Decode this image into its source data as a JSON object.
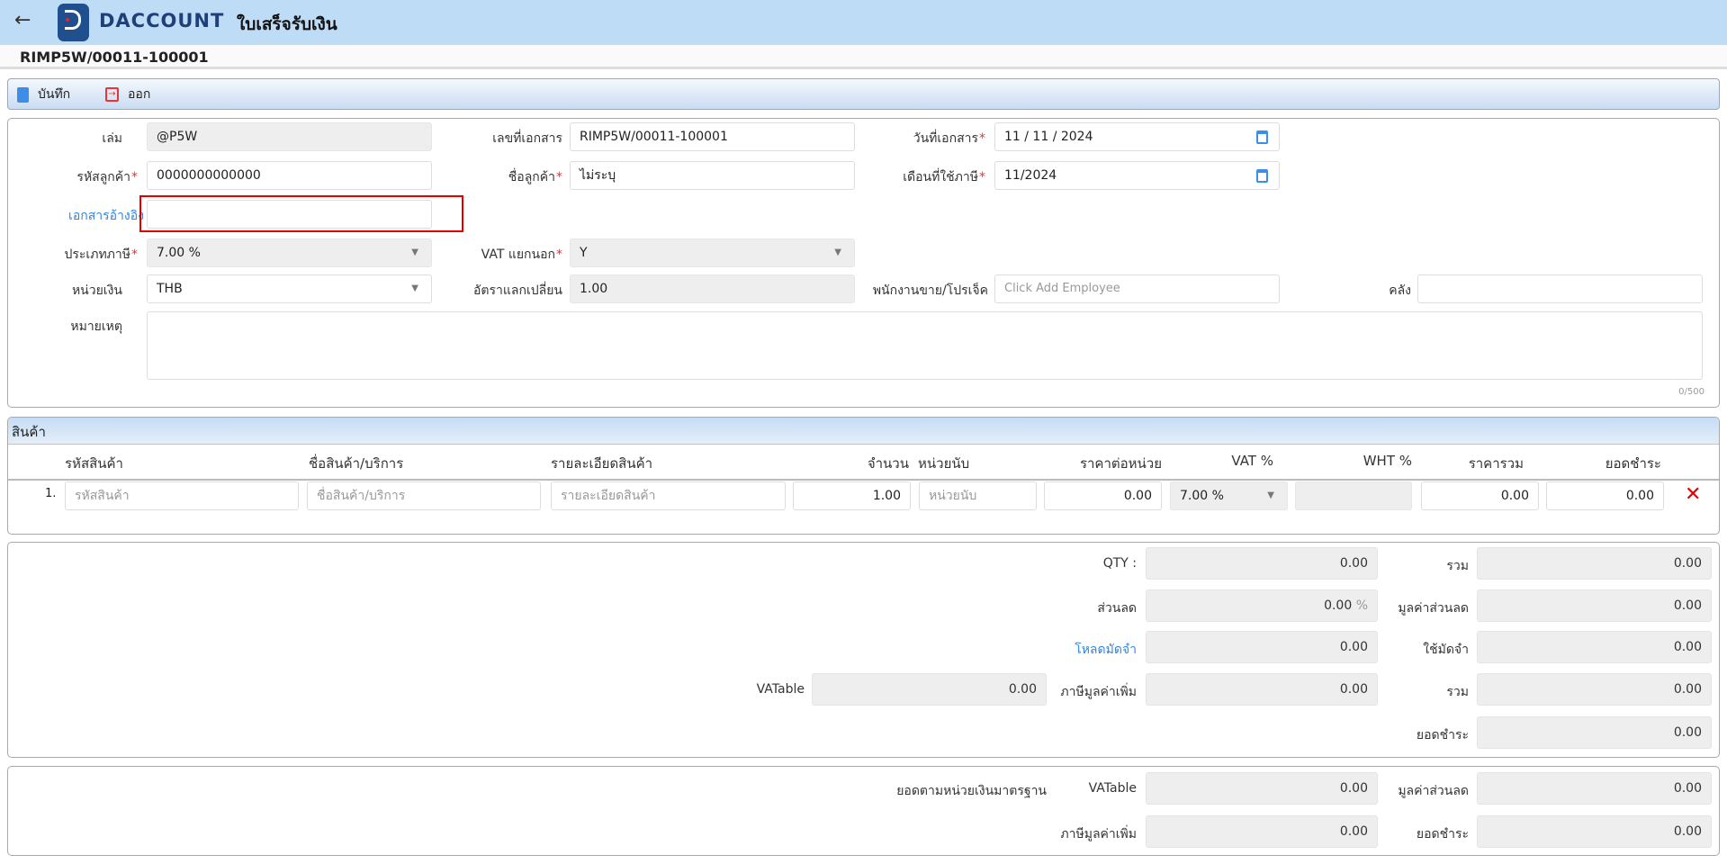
{
  "header": {
    "logo_text": "DACCOUNT",
    "page_title": "ใบเสร็จรับเงิน",
    "doc_number": "RIMP5W/00011-100001"
  },
  "toolbar": {
    "save_label": "บันทึก",
    "exit_label": "ออก"
  },
  "form": {
    "book": {
      "label": "เล่ม",
      "value": "@P5W"
    },
    "doc_no": {
      "label": "เลขที่เอกสาร",
      "value": "RIMP5W/00011-100001"
    },
    "doc_date": {
      "label": "วันที่เอกสาร",
      "value": "11 / 11 /  2024"
    },
    "customer_code": {
      "label": "รหัสลูกค้า",
      "value": "0000000000000"
    },
    "customer_name": {
      "label": "ชื่อลูกค้า",
      "value": "ไม่ระบุ"
    },
    "tax_month": {
      "label": "เดือนที่ใช้ภาษี",
      "value": "11/2024"
    },
    "reference_doc": {
      "label": "เอกสารอ้างอิง",
      "value": ""
    },
    "tax_type": {
      "label": "ประเภทภาษี",
      "value": "7.00 %"
    },
    "vat_separate": {
      "label": "VAT แยกนอก",
      "value": "Y"
    },
    "currency": {
      "label": "หน่วยเงิน",
      "value": "THB"
    },
    "exchange_rate": {
      "label": "อัตราแลกเปลี่ยน",
      "value": "1.00"
    },
    "employee": {
      "label": "พนักงานขาย/โปรเจ็ค",
      "placeholder": "Click Add Employee"
    },
    "warehouse": {
      "label": "คลัง",
      "value": ""
    },
    "remark": {
      "label": "หมายเหตุ",
      "counter": "0/500"
    }
  },
  "products": {
    "title": "สินค้า",
    "columns": [
      "รหัสสินค้า",
      "ชื่อสินค้า/บริการ",
      "รายละเอียดสินค้า",
      "จำนวน",
      "หน่วยนับ",
      "ราคาต่อหน่วย",
      "VAT %",
      "WHT %",
      "ราคารวม",
      "ยอดชำระ"
    ],
    "rows": [
      {
        "no": "1.",
        "code_ph": "รหัสสินค้า",
        "name_ph": "ชื่อสินค้า/บริการ",
        "detail_ph": "รายละเอียดสินค้า",
        "qty": "1.00",
        "unit_ph": "หน่วยนับ",
        "price": "0.00",
        "vat": "7.00 %",
        "wht": "",
        "total": "0.00",
        "pay": "0.00"
      }
    ]
  },
  "totals": {
    "qty": {
      "label": "QTY :",
      "value": "0.00"
    },
    "sum": {
      "label": "รวม",
      "value": "0.00"
    },
    "discount": {
      "label": "ส่วนลด",
      "value": "0.00",
      "unit": "%"
    },
    "discount_value": {
      "label": "มูลค่าส่วนลด",
      "value": "0.00"
    },
    "load_deposit": {
      "label": "โหลดมัดจำ",
      "value": "0.00"
    },
    "use_deposit": {
      "label": "ใช้มัดจำ",
      "value": "0.00"
    },
    "vatable": {
      "label": "VATable",
      "value": "0.00"
    },
    "vat_amount": {
      "label": "ภาษีมูลค่าเพิ่ม",
      "value": "0.00"
    },
    "sum2": {
      "label": "รวม",
      "value": "0.00"
    },
    "net": {
      "label": "ยอดชำระ",
      "value": "0.00"
    }
  },
  "standard": {
    "title": "ยอดตามหน่วยเงินมาตรฐาน",
    "vatable": {
      "label": "VATable",
      "value": "0.00"
    },
    "discount_value": {
      "label": "มูลค่าส่วนลด",
      "value": "0.00"
    },
    "vat_amount": {
      "label": "ภาษีมูลค่าเพิ่ม",
      "value": "0.00"
    },
    "net": {
      "label": "ยอดชำระ",
      "value": "0.00"
    }
  },
  "colors": {
    "header_bg": "#bfdcf7",
    "link": "#2f86e0",
    "highlight_box": "#e00000",
    "delete": "#e00000"
  }
}
